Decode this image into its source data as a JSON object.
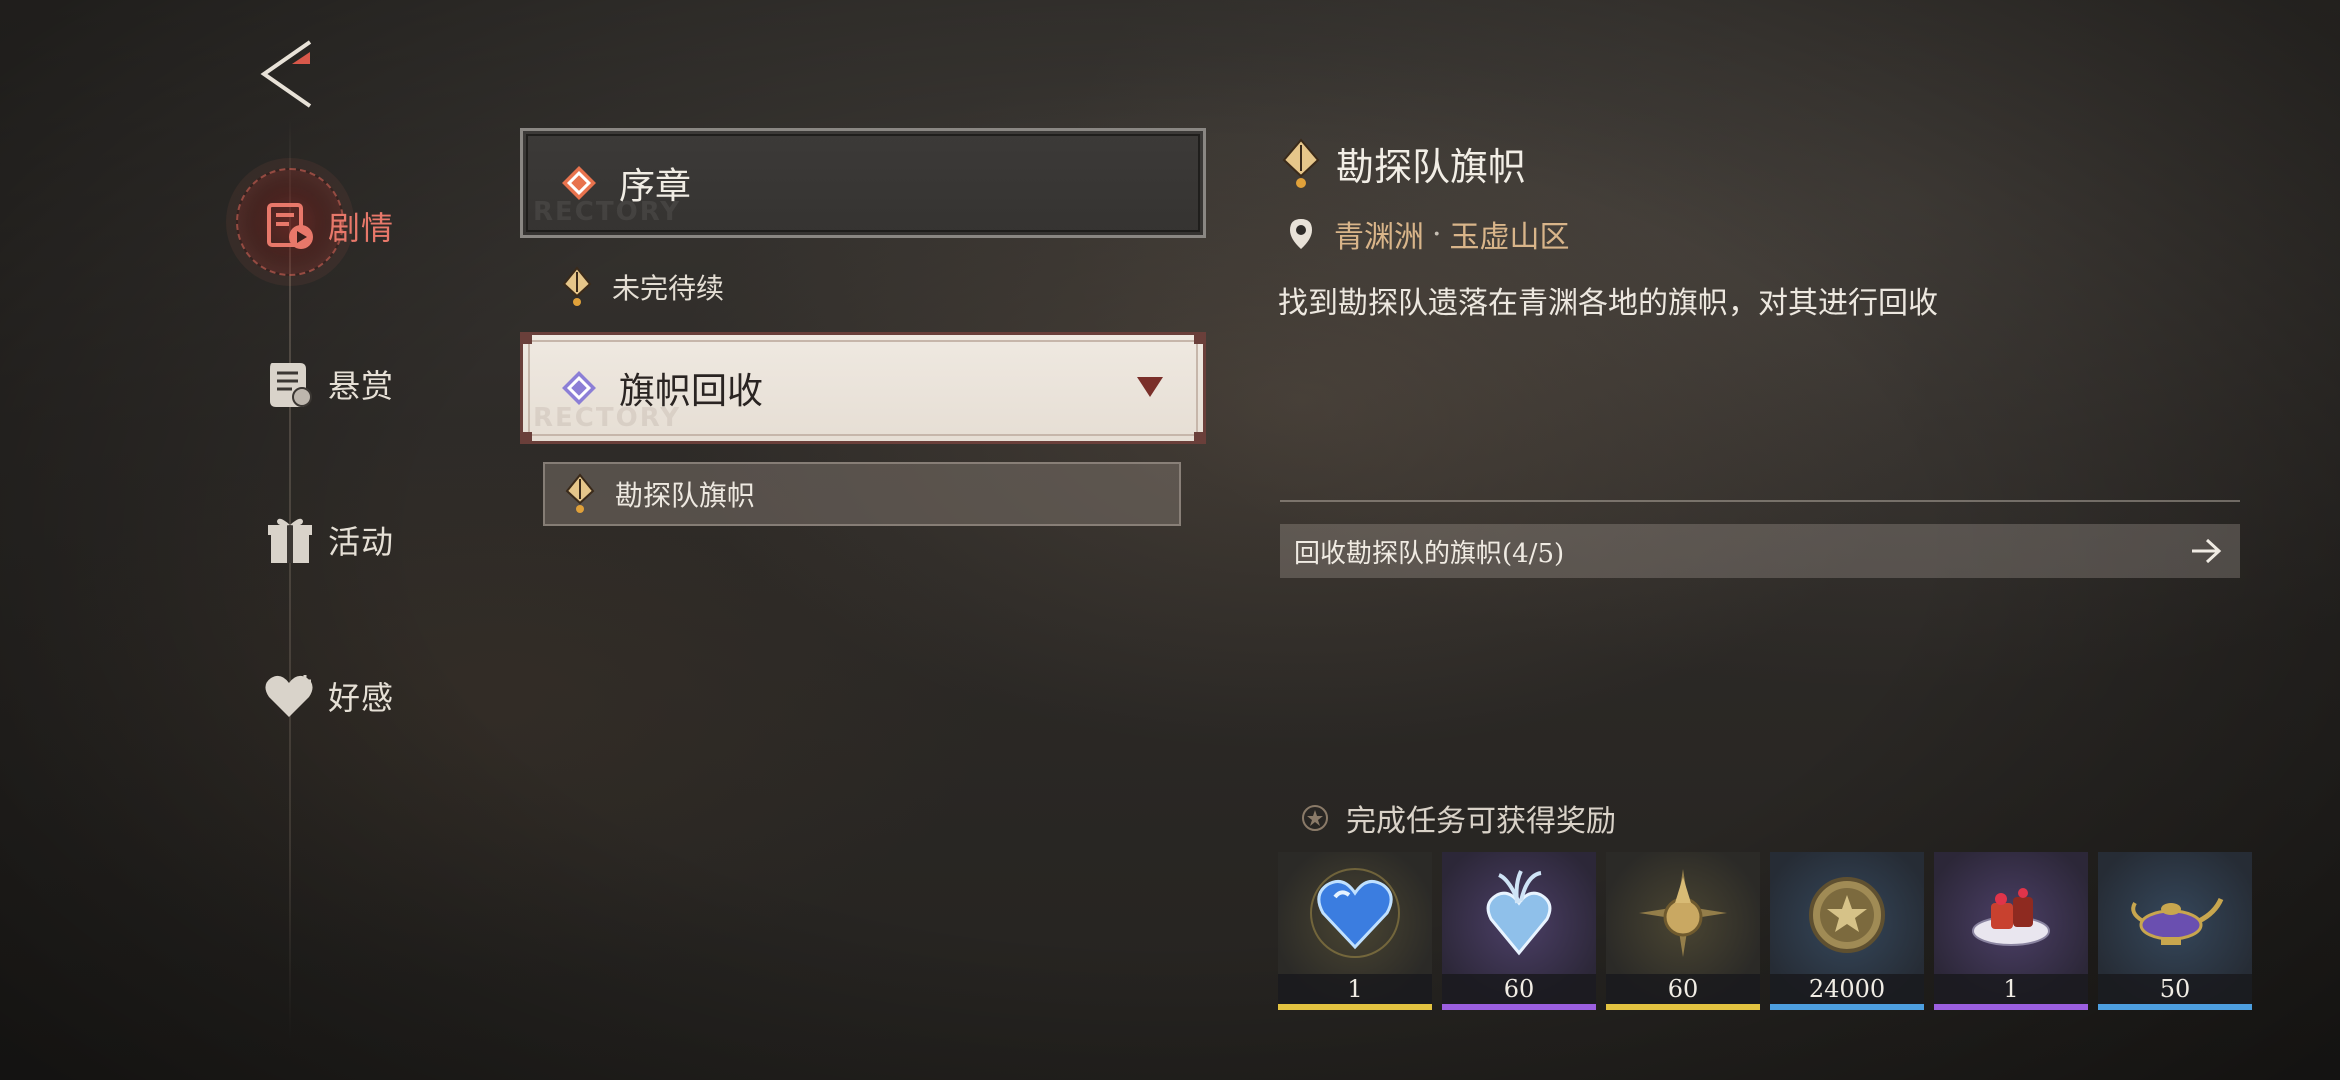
{
  "nav": {
    "items": [
      {
        "label": "剧情",
        "icon": "story-icon",
        "active": true
      },
      {
        "label": "悬赏",
        "icon": "bounty-scroll-icon",
        "active": false
      },
      {
        "label": "活动",
        "icon": "gift-icon",
        "active": false
      },
      {
        "label": "好感",
        "icon": "heart-icon",
        "active": false
      }
    ]
  },
  "quest_list": {
    "chapter_1": {
      "label": "序章",
      "watermark": "RECTORY"
    },
    "chapter_1_sub": {
      "label": "未完待续"
    },
    "chapter_2": {
      "label": "旗帜回收",
      "watermark": "RECTORY"
    },
    "chapter_2_quest": {
      "label": "勘探队旗帜"
    }
  },
  "detail": {
    "title": "勘探队旗帜",
    "location_region": "青渊洲",
    "location_sep": "·",
    "location_area": "玉虚山区",
    "description": "找到勘探队遗落在青渊各地的旗帜，对其进行回收",
    "objective": "回收勘探队的旗帜(4/5)"
  },
  "rewards": {
    "title": "完成任务可获得奖励",
    "items": [
      {
        "qty": "1",
        "icon": "blue-heart-gem-icon",
        "rarity_color": "#e3c341"
      },
      {
        "qty": "60",
        "icon": "crystal-heart-icon",
        "rarity_color": "#9b5fe0"
      },
      {
        "qty": "60",
        "icon": "golden-star-orb-icon",
        "rarity_color": "#e3c341"
      },
      {
        "qty": "24000",
        "icon": "gold-coin-icon",
        "rarity_color": "#4d9fe0"
      },
      {
        "qty": "1",
        "icon": "cake-dessert-icon",
        "rarity_color": "#9b5fe0"
      },
      {
        "qty": "50",
        "icon": "magic-lamp-icon",
        "rarity_color": "#4d9fe0"
      }
    ]
  }
}
